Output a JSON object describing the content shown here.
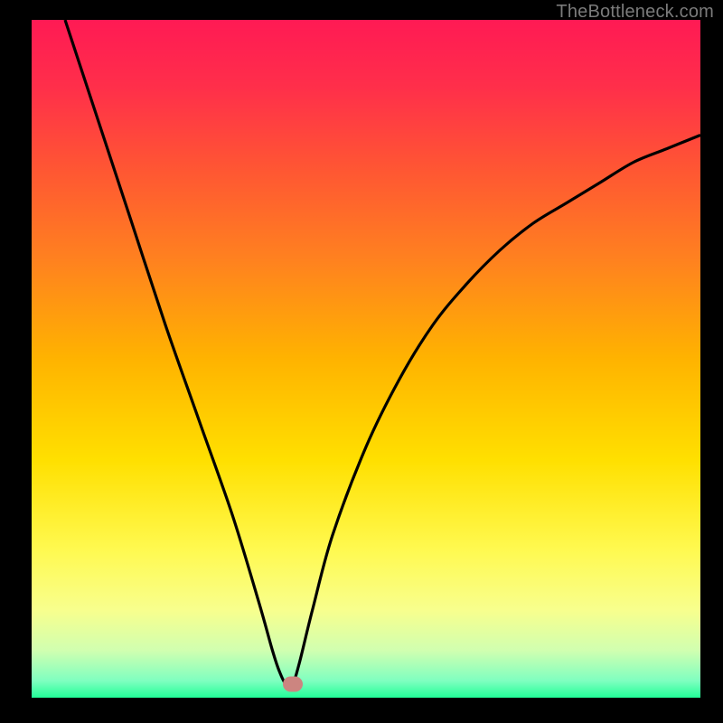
{
  "watermark": "TheBottleneck.com",
  "colors": {
    "background": "#000000",
    "curve": "#000000",
    "marker": "#cc8580",
    "watermark": "#7b7b7b"
  },
  "gradient_stops": [
    {
      "offset": 0.0,
      "color": "#ff1a54"
    },
    {
      "offset": 0.1,
      "color": "#ff2f4a"
    },
    {
      "offset": 0.22,
      "color": "#ff5633"
    },
    {
      "offset": 0.35,
      "color": "#ff8020"
    },
    {
      "offset": 0.5,
      "color": "#ffb300"
    },
    {
      "offset": 0.65,
      "color": "#ffe000"
    },
    {
      "offset": 0.78,
      "color": "#fff94f"
    },
    {
      "offset": 0.87,
      "color": "#f8ff8d"
    },
    {
      "offset": 0.93,
      "color": "#d1ffb0"
    },
    {
      "offset": 0.975,
      "color": "#7fffc0"
    },
    {
      "offset": 1.0,
      "color": "#22ff98"
    }
  ],
  "chart_data": {
    "type": "line",
    "title": "",
    "xlabel": "",
    "ylabel": "",
    "xlim": [
      0,
      100
    ],
    "ylim": [
      0,
      100
    ],
    "minimum_x": 38,
    "marker": {
      "x": 39,
      "y": 2
    },
    "series": [
      {
        "name": "bottleneck-curve",
        "x": [
          5,
          10,
          15,
          20,
          25,
          30,
          34,
          36,
          37,
          38,
          39,
          40,
          42,
          45,
          50,
          55,
          60,
          65,
          70,
          75,
          80,
          85,
          90,
          95,
          100
        ],
        "y": [
          100,
          85,
          70,
          55,
          41,
          27,
          14,
          7,
          4,
          2,
          2,
          5,
          13,
          24,
          37,
          47,
          55,
          61,
          66,
          70,
          73,
          76,
          79,
          81,
          83
        ]
      }
    ]
  }
}
